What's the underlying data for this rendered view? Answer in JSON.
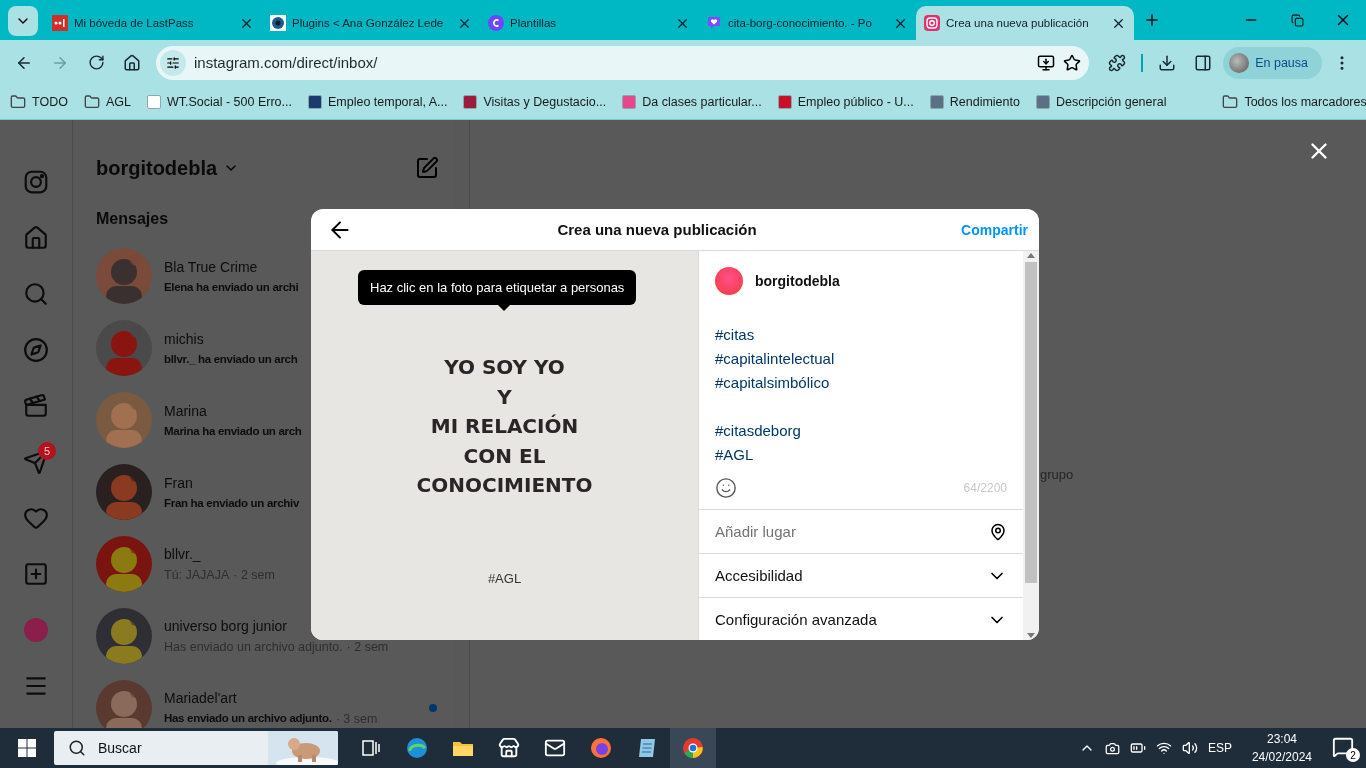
{
  "browser": {
    "tabs": [
      {
        "title": "Mi bóveda de LastPass",
        "kind": "lastpass",
        "selected": false
      },
      {
        "title": "Plugins < Ana González Lede",
        "kind": "eye",
        "selected": false
      },
      {
        "title": "Plantillas",
        "kind": "canva",
        "selected": false
      },
      {
        "title": "cita-borg-conocimiento. - Po",
        "kind": "heart",
        "selected": false
      },
      {
        "title": "Crea una nueva publicación",
        "kind": "instagram",
        "selected": true
      }
    ],
    "forward_disabled": true,
    "address": "instagram.com/direct/inbox/",
    "profile": "En pausa",
    "bookmarks": [
      {
        "label": "TODO",
        "kind": "folder"
      },
      {
        "label": "AGL",
        "kind": "folder"
      },
      {
        "label": "WT.Social - 500 Erro...",
        "kind": "site",
        "color": "#ffffff"
      },
      {
        "label": "Empleo temporal, A...",
        "kind": "site",
        "color": "#1c3a6e"
      },
      {
        "label": "Visitas y Degustacio...",
        "kind": "site",
        "color": "#9c1c3b"
      },
      {
        "label": "Da clases particular...",
        "kind": "site",
        "color": "#e8478b"
      },
      {
        "label": "Empleo público - U...",
        "kind": "site",
        "color": "#c8102e"
      },
      {
        "label": "Rendimiento",
        "kind": "site",
        "color": "#5b6f86"
      },
      {
        "label": "Descripción general",
        "kind": "site",
        "color": "#5b6f86"
      }
    ],
    "all_bookmarks": "Todos los marcadores"
  },
  "nav": [
    {
      "kind": "instagram"
    },
    {
      "kind": "home"
    },
    {
      "kind": "search"
    },
    {
      "kind": "explore"
    },
    {
      "kind": "reels"
    },
    {
      "kind": "messages",
      "badge": "5"
    },
    {
      "kind": "notifications"
    },
    {
      "kind": "create"
    },
    {
      "kind": "profile"
    },
    {
      "kind": "more"
    }
  ],
  "inbox": {
    "username": "borgitodebla",
    "section": "Mensajes",
    "conversations": [
      {
        "name": "Bla True Crime",
        "preview": "Elena ha enviado un archi",
        "unread": true,
        "dot": false
      },
      {
        "name": "michis",
        "preview": "bllvr._ ha enviado un arch",
        "unread": true,
        "dot": false
      },
      {
        "name": "Marina",
        "preview": "Marina ha enviado un arch",
        "unread": true,
        "dot": false
      },
      {
        "name": "Fran",
        "preview": "Fran ha enviado un archiv",
        "unread": true,
        "dot": false
      },
      {
        "name": "bllvr._",
        "preview": "Tú: JAJAJA",
        "time": "· 2 sem",
        "unread": false,
        "dot": false
      },
      {
        "name": "universo borg junior",
        "preview": "Has enviado un archivo adjunto.",
        "time": "· 2 sem",
        "unread": false,
        "dot": false
      },
      {
        "name": "Mariadel'art",
        "preview": "Has enviado un archivo adjunto.",
        "time": "· 3 sem",
        "unread": true,
        "dot": true
      }
    ]
  },
  "background_text": "grupo",
  "modal": {
    "title": "Crea una nueva publicación",
    "share": "Compartir",
    "image": {
      "lines": [
        "YO SOY YO",
        "Y",
        "MI RELACIÓN",
        "CON EL",
        "CONOCIMIENTO"
      ],
      "footer": "#AGL"
    },
    "tooltip": "Haz clic en la foto para etiquetar a personas",
    "author": "borgitodebla",
    "caption": [
      [
        "#citas",
        "#capitalintelectual",
        "#capitalsimbólico"
      ],
      [
        "#citasdeborg",
        "#AGL"
      ]
    ],
    "counter": "64/2200",
    "location_placeholder": "Añadir lugar",
    "sections": [
      {
        "label": "Accesibilidad",
        "expanded": false
      },
      {
        "label": "Configuración avanzada",
        "expanded": false
      }
    ]
  },
  "taskbar": {
    "search": "Buscar",
    "language": "ESP",
    "time": "23:04",
    "date": "24/02/2024",
    "notifications": "2"
  }
}
